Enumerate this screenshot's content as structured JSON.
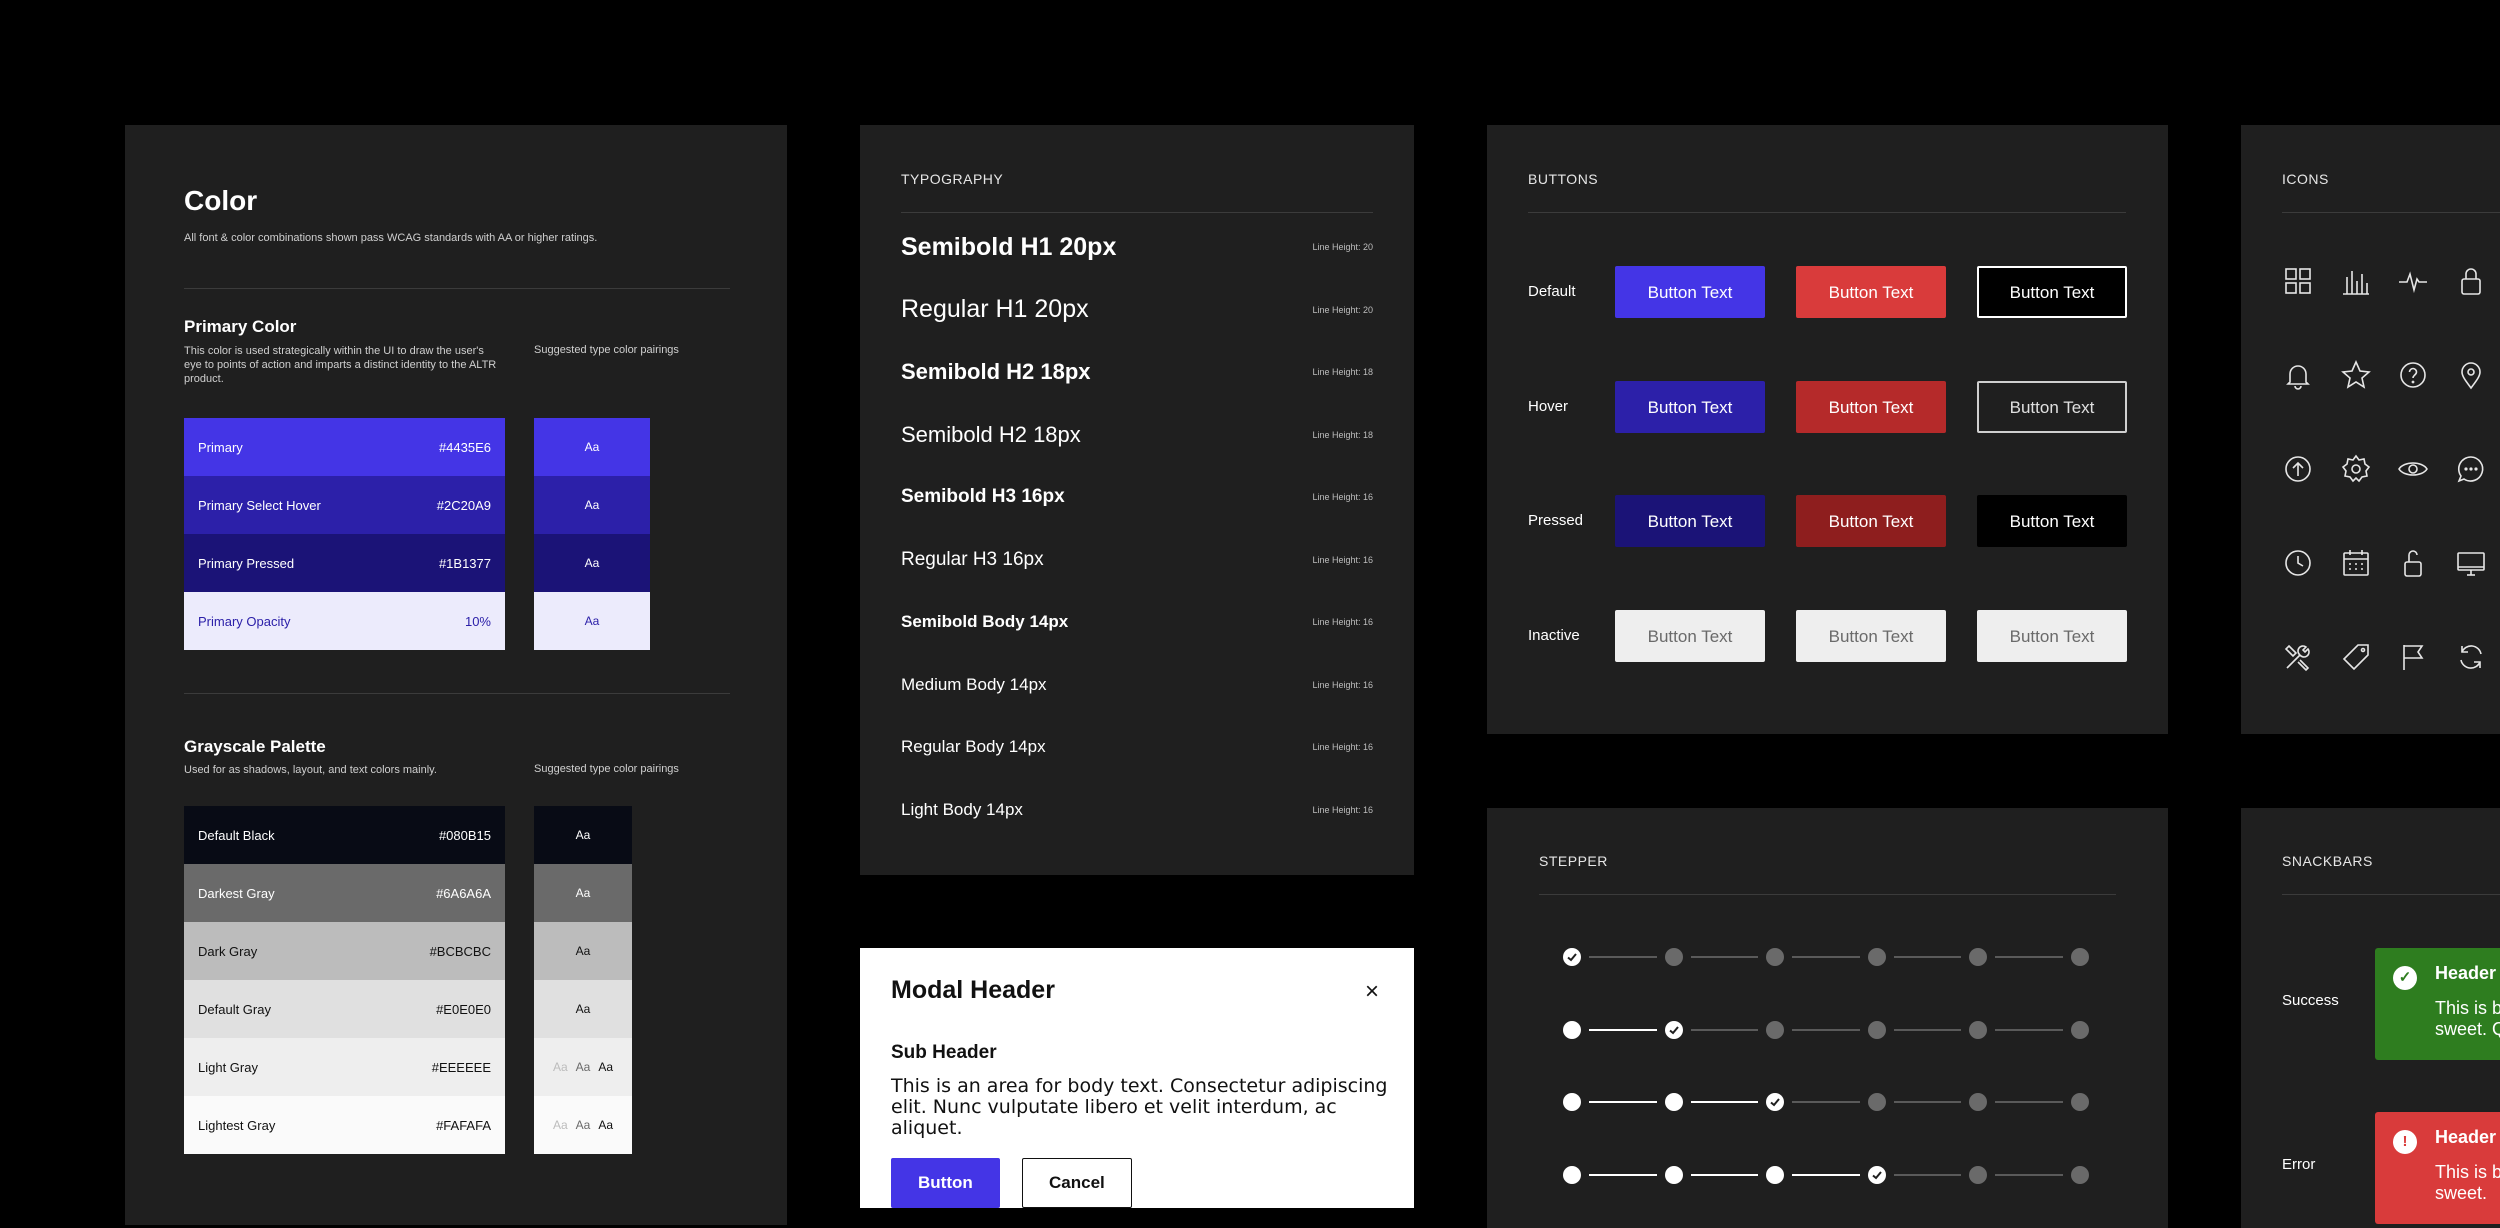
{
  "color": {
    "title": "Color",
    "subtitle": "All font & color combinations shown pass WCAG standards with AA or higher ratings.",
    "primary": {
      "heading": "Primary Color",
      "description": "This color is used strategically within the UI to draw the user's eye to points of action and imparts a distinct identity to the ALTR product.",
      "pair_label": "Suggested type color pairings",
      "swatches": [
        {
          "name": "Primary",
          "value": "#4435E6",
          "bg": "#4435E6",
          "fg": "#ffffff"
        },
        {
          "name": "Primary Select Hover",
          "value": "#2C20A9",
          "bg": "#2C20A9",
          "fg": "#ffffff"
        },
        {
          "name": "Primary Pressed",
          "value": "#1B1377",
          "bg": "#1B1377",
          "fg": "#ffffff"
        },
        {
          "name": "Primary Opacity",
          "value": "10%",
          "bg": "#ECEBFC",
          "fg": "#2C20A9"
        }
      ],
      "pairs": [
        {
          "text": "Aa",
          "bg": "#4435E6",
          "fg": "#ffffff"
        },
        {
          "text": "Aa",
          "bg": "#2C20A9",
          "fg": "#ffffff"
        },
        {
          "text": "Aa",
          "bg": "#1B1377",
          "fg": "#ffffff"
        },
        {
          "text": "Aa",
          "bg": "#ECEBFC",
          "fg": "#2C20A9"
        }
      ]
    },
    "grayscale": {
      "heading": "Grayscale Palette",
      "description": "Used for as shadows, layout, and text colors mainly.",
      "pair_label": "Suggested type color pairings",
      "swatches": [
        {
          "name": "Default Black",
          "value": "#080B15",
          "bg": "#080B15",
          "fg": "#ffffff"
        },
        {
          "name": "Darkest Gray",
          "value": "#6A6A6A",
          "bg": "#6A6A6A",
          "fg": "#ffffff"
        },
        {
          "name": "Dark Gray",
          "value": "#BCBCBC",
          "bg": "#BCBCBC",
          "fg": "#111111"
        },
        {
          "name": "Default Gray",
          "value": "#E0E0E0",
          "bg": "#E0E0E0",
          "fg": "#111111"
        },
        {
          "name": "Light Gray",
          "value": "#EEEEEE",
          "bg": "#EEEEEE",
          "fg": "#111111"
        },
        {
          "name": "Lightest Gray",
          "value": "#FAFAFA",
          "bg": "#FAFAFA",
          "fg": "#111111"
        }
      ],
      "pairs": [
        {
          "texts": [
            "Aa"
          ],
          "colors": [
            "#ffffff"
          ],
          "bg": "#080B15"
        },
        {
          "texts": [
            "Aa"
          ],
          "colors": [
            "#ffffff"
          ],
          "bg": "#6A6A6A"
        },
        {
          "texts": [
            "Aa"
          ],
          "colors": [
            "#111111"
          ],
          "bg": "#BCBCBC"
        },
        {
          "texts": [
            "Aa"
          ],
          "colors": [
            "#111111"
          ],
          "bg": "#E0E0E0"
        },
        {
          "texts": [
            "Aa",
            "Aa",
            "Aa"
          ],
          "colors": [
            "#BCBCBC",
            "#6A6A6A",
            "#111111"
          ],
          "bg": "#EEEEEE"
        },
        {
          "texts": [
            "Aa",
            "Aa",
            "Aa"
          ],
          "colors": [
            "#BCBCBC",
            "#6A6A6A",
            "#111111"
          ],
          "bg": "#FAFAFA"
        }
      ]
    }
  },
  "typography": {
    "label": "TYPOGRAPHY",
    "rows": [
      {
        "text": "Semibold H1 20px",
        "lh": "Line Height: 20",
        "size": 25,
        "weight": "bold"
      },
      {
        "text": "Regular H1 20px",
        "lh": "Line Height: 20",
        "size": 25,
        "weight": "normal"
      },
      {
        "text": "Semibold H2 18px",
        "lh": "Line Height: 18",
        "size": 22,
        "weight": "bold"
      },
      {
        "text": "Semibold H2 18px",
        "lh": "Line Height: 18",
        "size": 22,
        "weight": "normal"
      },
      {
        "text": "Semibold H3 16px",
        "lh": "Line Height: 16",
        "size": 19,
        "weight": "bold"
      },
      {
        "text": "Regular H3 16px",
        "lh": "Line Height: 16",
        "size": 19,
        "weight": "normal"
      },
      {
        "text": "Semibold Body 14px",
        "lh": "Line Height: 16",
        "size": 17,
        "weight": "bold"
      },
      {
        "text": "Medium Body 14px",
        "lh": "Line Height: 16",
        "size": 17,
        "weight": "normal"
      },
      {
        "text": "Regular Body 14px",
        "lh": "Line Height: 16",
        "size": 17,
        "weight": "normal"
      },
      {
        "text": "Light Body 14px",
        "lh": "Line Height: 16",
        "size": 17,
        "weight": "normal"
      }
    ]
  },
  "modal": {
    "header": "Modal Header",
    "close": "×",
    "sub_header": "Sub Header",
    "body": "This is an area for body text. Consectetur adipiscing elit. Nunc vulputate libero et velit interdum, ac aliquet.",
    "primary_button": "Button",
    "cancel_button": "Cancel"
  },
  "buttons": {
    "label": "BUTTONS",
    "button_text": "Button Text",
    "states": [
      {
        "name": "Default",
        "colors": [
          {
            "bg": "#4435E6",
            "fg": "#ffffff",
            "border": "#4435E6"
          },
          {
            "bg": "#D93B3B",
            "fg": "#ffffff",
            "border": "#D93B3B"
          },
          {
            "bg": "#000000",
            "fg": "#ffffff",
            "border": "#ffffff"
          }
        ]
      },
      {
        "name": "Hover",
        "colors": [
          {
            "bg": "#2C20A9",
            "fg": "#ffffff",
            "border": "#2C20A9"
          },
          {
            "bg": "#B52A2A",
            "fg": "#ffffff",
            "border": "#B52A2A"
          },
          {
            "bg": "#1f1f1f",
            "fg": "#e0e0e0",
            "border": "#cfcfcf"
          }
        ]
      },
      {
        "name": "Pressed",
        "colors": [
          {
            "bg": "#1B1377",
            "fg": "#ffffff",
            "border": "#1B1377"
          },
          {
            "bg": "#8E1E1E",
            "fg": "#ffffff",
            "border": "#8E1E1E"
          },
          {
            "bg": "#000000",
            "fg": "#ffffff",
            "border": "#000000"
          }
        ]
      },
      {
        "name": "Inactive",
        "colors": [
          {
            "bg": "#EEEEEE",
            "fg": "#6A6A6A",
            "border": "#EEEEEE"
          },
          {
            "bg": "#EEEEEE",
            "fg": "#6A6A6A",
            "border": "#EEEEEE"
          },
          {
            "bg": "#EEEEEE",
            "fg": "#6A6A6A",
            "border": "#EEEEEE"
          }
        ]
      }
    ]
  },
  "stepper": {
    "label": "STEPPER",
    "steps_per_row": 6,
    "rows": [
      {
        "current_step": 1
      },
      {
        "current_step": 2
      },
      {
        "current_step": 3
      },
      {
        "current_step": 4
      }
    ]
  },
  "icons": {
    "label": "ICONS",
    "items": [
      "grid-icon",
      "bar-chart-icon",
      "activity-icon",
      "lock-icon",
      "bell-icon",
      "star-icon",
      "help-circle-icon",
      "map-pin-icon",
      "arrow-up-circle-icon",
      "gear-icon",
      "eye-icon",
      "chat-bubble-icon",
      "clock-icon",
      "calendar-icon",
      "unlock-icon",
      "monitor-icon",
      "tools-icon",
      "tag-icon",
      "flag-icon",
      "refresh-icon"
    ]
  },
  "snackbars": {
    "label": "SNACKBARS",
    "items": [
      {
        "name": "Success",
        "header": "Header T",
        "body1": "This is bo",
        "body2": "sweet. Q",
        "bg": "#2E7D1F",
        "icon": "✓",
        "icon_color": "#2E7D1F"
      },
      {
        "name": "Error",
        "header": "Header T",
        "body1": "This is bo",
        "body2": "sweet. ",
        "bg": "#D93B3B",
        "icon": "!",
        "icon_color": "#D93B3B"
      }
    ]
  }
}
